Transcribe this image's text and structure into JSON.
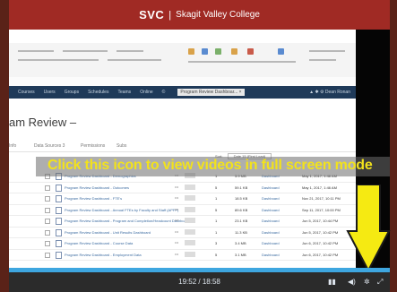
{
  "header": {
    "logo": "SVC",
    "separator": "|",
    "college_name": "Skagit Valley College"
  },
  "nav": {
    "items": [
      "Courses",
      "Users",
      "Groups",
      "Schedules",
      "Teams",
      "Online",
      "©"
    ],
    "tab": "Program Review Dashboar...  ×",
    "right": "▲  ✱  ⚙  Dean Ronan"
  },
  "page": {
    "title": "am Review  –"
  },
  "subtabs": [
    "Info",
    "Data Sources 3",
    "Permissions",
    "Subs"
  ],
  "sort": {
    "label": "Sort:",
    "value": "Date 15 (First Load)"
  },
  "rows": [
    {
      "name": "Program Review Dashboard - Demographics",
      "count": "1",
      "size": "3.9 MB",
      "type": "Dashboard",
      "date": "May 1, 2017, 1:46 AM"
    },
    {
      "name": "Program Review Dashboard - Outcomes",
      "count": "5",
      "size": "59.1 KB",
      "type": "Dashboard",
      "date": "May 1, 2017, 1:46 AM"
    },
    {
      "name": "Program Review Dashboard - FTE's",
      "count": "1",
      "size": "18.5 KB",
      "type": "Dashboard",
      "date": "Nov 21, 2017, 10:11 PM"
    },
    {
      "name": "Program Review Dashboard - Annual FTEs by Faculty and Staff (APFP)",
      "count": "5",
      "size": "89.6 KB",
      "type": "Dashboard",
      "date": "Sep 11, 2017, 10:00 PM"
    },
    {
      "name": "Program Review Dashboard - Program and Completion/Headcount Dashboard",
      "count": "1",
      "size": "23.1 KB",
      "type": "Dashboard",
      "date": "Jun 5, 2017, 10:44 PM"
    },
    {
      "name": "Program Review Dashboard - Unit Results Dashboard",
      "count": "1",
      "size": "11.3 KB",
      "type": "Dashboard",
      "date": "Jun 5, 2017, 10:42 PM"
    },
    {
      "name": "Program Review Dashboard - Course Data",
      "count": "3",
      "size": "3.4 MB",
      "type": "Dashboard",
      "date": "Jun 6, 2017, 10:42 PM"
    },
    {
      "name": "Program Review Dashboard - Employment Data",
      "count": "5",
      "size": "3.1 MB",
      "type": "Dashboard",
      "date": "Jun 6, 2017, 10:42 PM"
    }
  ],
  "banner": {
    "text": "Click this icon to view videos in full screen mode"
  },
  "player": {
    "progress": 0.0,
    "time": "19:52 / 18:58",
    "volume_icon": "volume-icon",
    "fullscreen_icon": "fullscreen-icon"
  },
  "colors": {
    "header": "#a02a24",
    "nav": "#1f3a59",
    "banner_text": "#f2e21c",
    "arrow": "#f5ea12",
    "progress": "#3ea6df"
  }
}
